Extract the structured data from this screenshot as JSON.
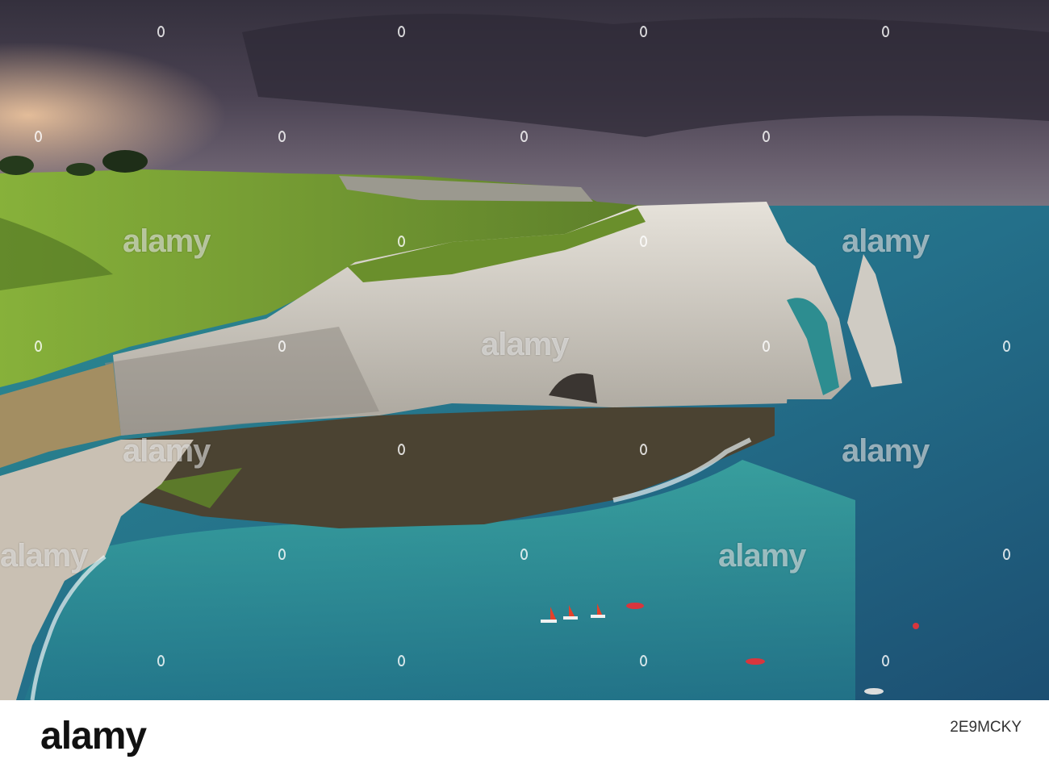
{
  "footer": {
    "brand": "alamy",
    "image_id": "2E9MCKY"
  },
  "watermarks": [
    "alamy",
    "alamy",
    "alamy",
    "alamy",
    "alamy",
    "alamy",
    "alamy"
  ],
  "colors": {
    "sky_dark": "#3d3848",
    "sky_warm": "#d49a7a",
    "sea_teal": "#2f8f92",
    "sea_deep": "#1f5d78",
    "cliff": "#d9d6cf",
    "grass": "#6f9c2e",
    "beach": "#c9c0b3",
    "sail": "#e4412a"
  }
}
